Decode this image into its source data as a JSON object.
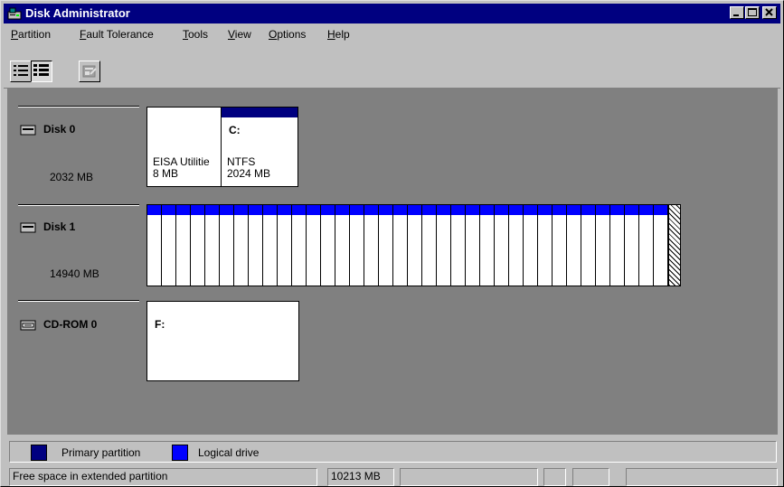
{
  "window": {
    "title": "Disk Administrator"
  },
  "menu": [
    {
      "prefix": "",
      "accel": "P",
      "rest": "artition"
    },
    {
      "prefix": "",
      "accel": "F",
      "rest": "ault Tolerance"
    },
    {
      "prefix": "",
      "accel": "T",
      "rest": "ools"
    },
    {
      "prefix": "",
      "accel": "V",
      "rest": "iew"
    },
    {
      "prefix": "",
      "accel": "O",
      "rest": "ptions"
    },
    {
      "prefix": "",
      "accel": "H",
      "rest": "elp"
    }
  ],
  "toolbar": {
    "buttons": [
      "volumes-view-icon",
      "disk-config-view-icon",
      "properties-icon"
    ]
  },
  "disks": [
    {
      "name": "Disk 0",
      "size": "2032 MB",
      "icon": "hard-disk-icon",
      "partitions": [
        {
          "drive": "",
          "line1": "EISA Utilitie",
          "line2": "8 MB"
        },
        {
          "drive": "C:",
          "line1": "NTFS",
          "line2": "2024 MB"
        }
      ]
    },
    {
      "name": "Disk 1",
      "size": "14940 MB",
      "icon": "hard-disk-icon"
    },
    {
      "name": "CD-ROM 0",
      "size": "",
      "icon": "cdrom-icon",
      "partitions": [
        {
          "drive": "F:",
          "line1": "",
          "line2": ""
        }
      ]
    }
  ],
  "legend": {
    "primary_label": "Primary partition",
    "logical_label": "Logical drive",
    "primary_color": "#000080",
    "logical_color": "#0000ff"
  },
  "status": {
    "description": "Free space in extended partition",
    "size": "10213 MB",
    "cell3": "",
    "cell4": "",
    "cell5": ""
  }
}
